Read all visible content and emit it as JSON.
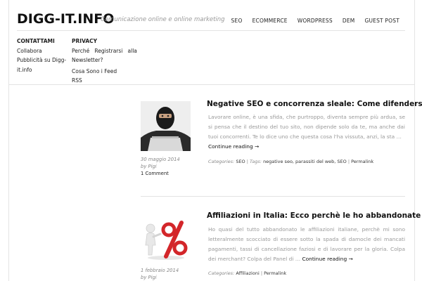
{
  "header": {
    "logo": "DIGG-IT.INFO",
    "tagline": "Comunicazione online e online marketing",
    "nav": [
      "SEO",
      "ECOMMERCE",
      "WORDPRESS",
      "DEM",
      "GUEST POST"
    ]
  },
  "menus": {
    "contact": {
      "heading": "CONTATTAMI",
      "items": [
        "Collabora",
        "Pubblicità su Digg-it.info"
      ]
    },
    "privacy": {
      "heading": "PRIVACY",
      "items": [
        "Perché   Registrarsi   alla",
        "Newsletter?",
        "Cosa Sono i Feed RSS"
      ]
    }
  },
  "posts": [
    {
      "title": "Negative SEO e concorrenza sleale: Come difendersi?",
      "excerpt": "Lavorare online, è una sfida, che purtroppo, diventa sempre più ardua, se si pensa che il destino del tuo sito, non dipende solo da te, ma anche dai tuoi concorrenti. Te lo dice uno che questa cosa l'ha vissuta, anzi, la sta …",
      "more": "Continue reading →",
      "date": "30 maggio 2014",
      "author": "by Pigi",
      "comments": "1 Comment",
      "categories_label": "Categories:",
      "categories": "SEO",
      "tags_label": "Tags:",
      "tags": "negative seo, parassiti del web, SEO",
      "permalink": "Permalink"
    },
    {
      "title": "Affiliazioni in Italia: Ecco perchè le ho abbandonate",
      "excerpt": "Ho quasi del tutto abbandonato le affiliazioni italiane, perchè mi sono letteralmente scocciato di essere sotto la spada di damocle dei mancati pagamenti, tassi di cancellazione faziosi e di lavorare per la gloria. Colpa dei merchant? Colpa del Panel di …",
      "more": "Continue reading →",
      "date": "1 febbraio 2014",
      "author": "by Pigi",
      "categories_label": "Categories:",
      "categories": "Affiliazioni",
      "permalink": "Permalink"
    }
  ]
}
